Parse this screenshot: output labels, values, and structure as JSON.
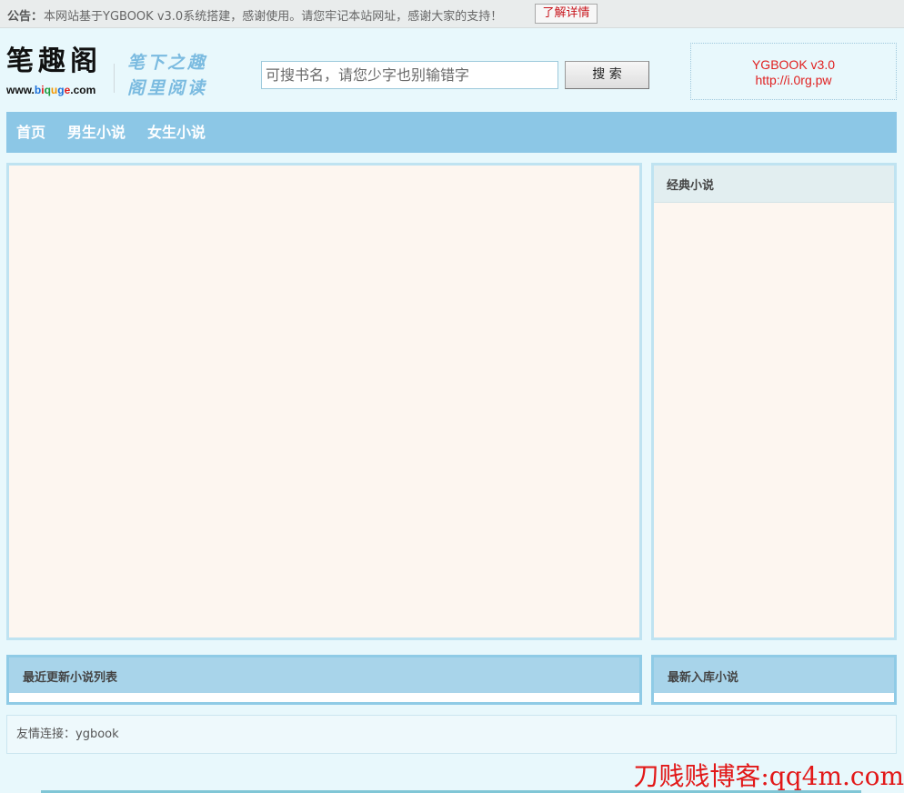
{
  "notice": {
    "label": "公告：",
    "text": "本网站基于YGBOOK v3.0系统搭建，感谢使用。请您牢记本站网址，感谢大家的支持！",
    "button": "了解详情"
  },
  "logo": {
    "title": "笔趣阁",
    "domain": {
      "prefix": "www.",
      "letters": [
        "b",
        "i",
        "q",
        "u",
        "g",
        "e"
      ],
      "suffix": ".com"
    },
    "slogan_line1": "笔下之趣",
    "slogan_line2": "阁里阅读"
  },
  "search": {
    "placeholder": "可搜书名，请您少字也别输错字",
    "button": "搜 索"
  },
  "promo": {
    "line1": "YGBOOK v3.0",
    "line2": "http://i.0rg.pw"
  },
  "nav": [
    {
      "label": "首页"
    },
    {
      "label": "男生小说"
    },
    {
      "label": "女生小说"
    }
  ],
  "classic_panel": {
    "title": "经典小说"
  },
  "latest_updates": {
    "title": "最近更新小说列表"
  },
  "newest_added": {
    "title": "最新入库小说"
  },
  "friend_links": {
    "label": "友情连接：",
    "items": [
      "ygbook"
    ]
  },
  "watermark": "刀贱贱博客:qq4m.com",
  "colors": {
    "page_bg": "#e8f8fc",
    "nav_bg": "#8cc7e6",
    "panel_bg": "#fdf6f0",
    "list_header_bg": "#a8d4ea",
    "accent_red": "#e02020"
  }
}
